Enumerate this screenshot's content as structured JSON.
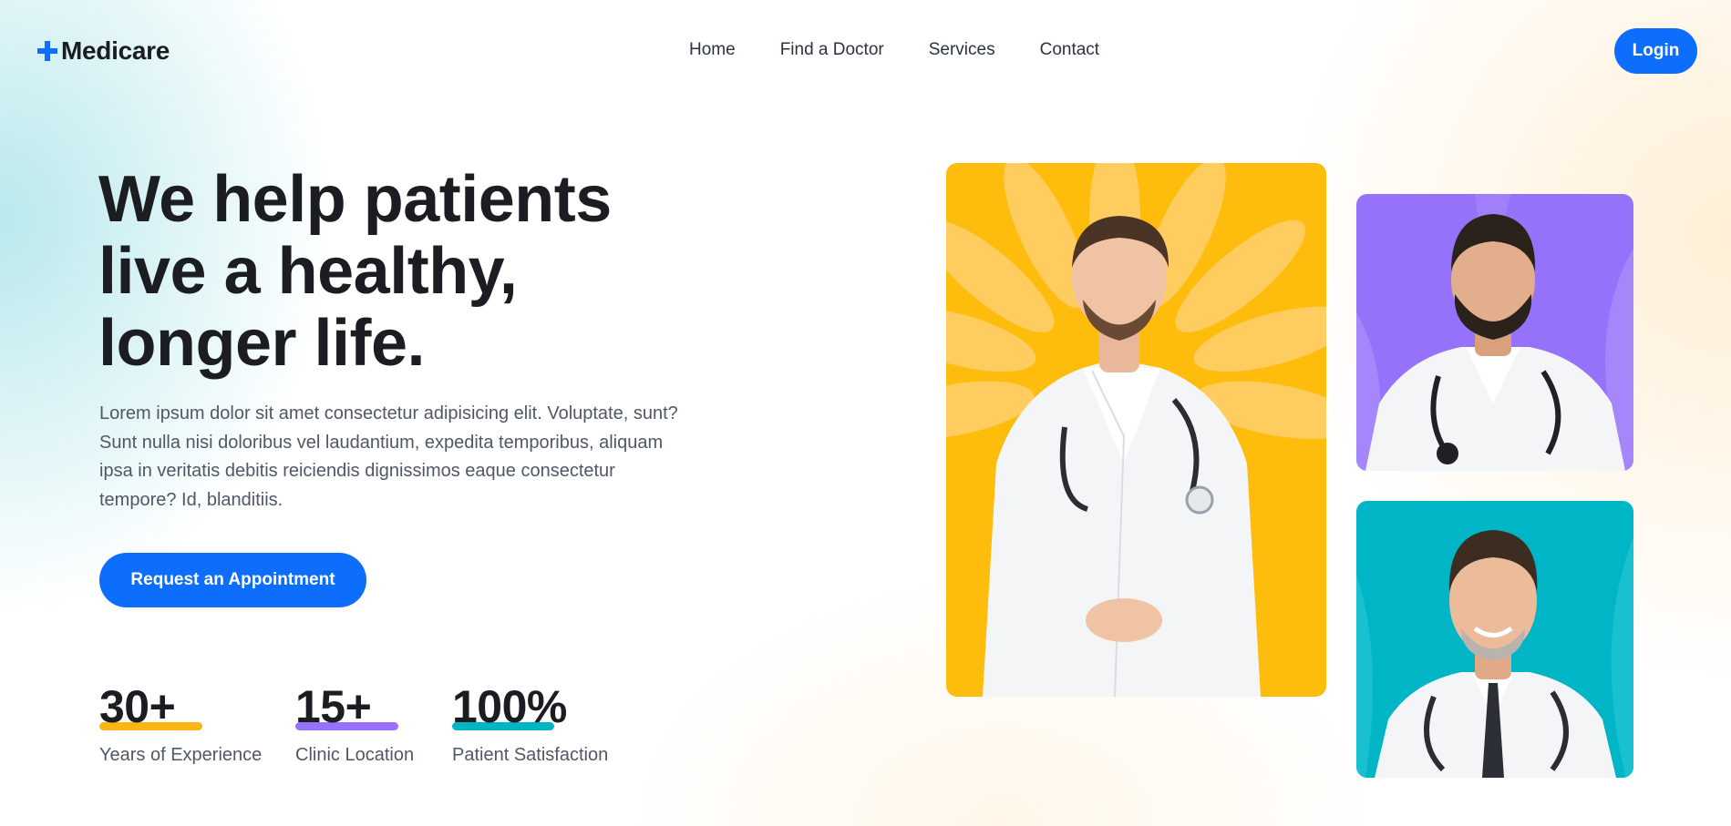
{
  "brand": {
    "name": "Medicare",
    "icon": "plus-icon",
    "accent": "#0d6efd"
  },
  "nav": {
    "items": [
      "Home",
      "Find a Doctor",
      "Services",
      "Contact"
    ],
    "login_label": "Login"
  },
  "hero": {
    "title_lines": [
      "We help patients",
      "live a healthy,",
      "longer life."
    ],
    "description": "Lorem ipsum dolor sit amet consectetur adipisicing elit. Voluptate, sunt? Sunt nulla nisi doloribus vel laudantium, expedita temporibus, aliquam ipsa in veritatis debitis reiciendis dignissimos eaque consectetur tempore? Id, blanditiis.",
    "cta_label": "Request an Appointment"
  },
  "stats": [
    {
      "value": "30+",
      "label": "Years of Experience",
      "color": "#fbb616"
    },
    {
      "value": "15+",
      "label": "Clinic Location",
      "color": "#9771fa"
    },
    {
      "value": "100%",
      "label": "Patient Satisfaction",
      "color": "#01b5c5"
    }
  ],
  "doctor_cards": [
    {
      "name": "doctor-photo-main",
      "background": "#febc0d"
    },
    {
      "name": "doctor-photo-bearded",
      "background": "#9671fa"
    },
    {
      "name": "doctor-photo-smiling",
      "background": "#00b5c6"
    }
  ]
}
